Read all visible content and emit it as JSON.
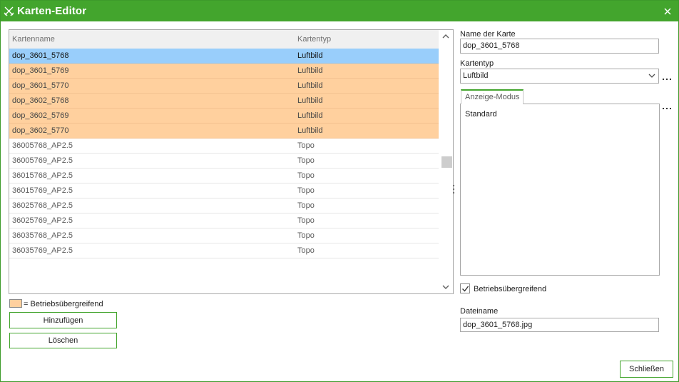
{
  "window": {
    "title": "Karten-Editor",
    "colors": {
      "titlebar": "#43a52d",
      "orange_row": "#ffd09e",
      "selected_row": "#99cefb"
    },
    "icons": {
      "app": "crossed-swords-icon",
      "close": "close-icon"
    }
  },
  "grid": {
    "columns": [
      "Kartenname",
      "Kartentyp"
    ],
    "rows": [
      {
        "name": "dop_3601_5768",
        "type": "Luftbild",
        "state": "selected"
      },
      {
        "name": "dop_3601_5769",
        "type": "Luftbild",
        "state": "orange"
      },
      {
        "name": "dop_3601_5770",
        "type": "Luftbild",
        "state": "orange"
      },
      {
        "name": "dop_3602_5768",
        "type": "Luftbild",
        "state": "orange"
      },
      {
        "name": "dop_3602_5769",
        "type": "Luftbild",
        "state": "orange"
      },
      {
        "name": "dop_3602_5770",
        "type": "Luftbild",
        "state": "orange"
      },
      {
        "name": "36005768_AP2.5",
        "type": "Topo",
        "state": "normal"
      },
      {
        "name": "36005769_AP2.5",
        "type": "Topo",
        "state": "normal"
      },
      {
        "name": "36015768_AP2.5",
        "type": "Topo",
        "state": "normal"
      },
      {
        "name": "36015769_AP2.5",
        "type": "Topo",
        "state": "normal"
      },
      {
        "name": "36025768_AP2.5",
        "type": "Topo",
        "state": "normal"
      },
      {
        "name": "36025769_AP2.5",
        "type": "Topo",
        "state": "normal"
      },
      {
        "name": "36035768_AP2.5",
        "type": "Topo",
        "state": "normal"
      },
      {
        "name": "36035769_AP2.5",
        "type": "Topo",
        "state": "normal"
      }
    ]
  },
  "legend": {
    "text": "= Betriebsübergreifend"
  },
  "buttons": {
    "add": "Hinzufügen",
    "delete": "Löschen",
    "close": "Schließen"
  },
  "details": {
    "name_label": "Name der Karte",
    "name_value": "dop_3601_5768",
    "type_label": "Kartentyp",
    "type_value": "Luftbild",
    "tab_label": "Anzeige-Modus",
    "modes": [
      "Standard"
    ],
    "checkbox_label": "Betriebsübergreifend",
    "checkbox_checked": true,
    "filename_label": "Dateiname",
    "filename_value": "dop_3601_5768.jpg"
  }
}
